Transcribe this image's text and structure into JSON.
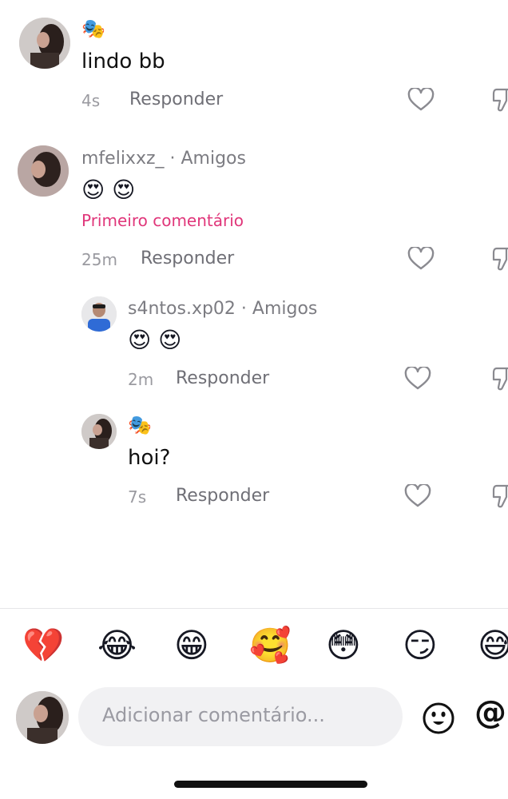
{
  "comments": [
    {
      "username": "",
      "badge_emoji": "🎭",
      "text": "lindo bb",
      "time": "4s",
      "reply_label": "Responder"
    },
    {
      "username": "mfelixxz_ · Amigos",
      "text": "😍 😍",
      "first_comment_label": "Primeiro comentário",
      "time": "25m",
      "reply_label": "Responder"
    },
    {
      "username": "s4ntos.xp02 · Amigos",
      "text": "😍 😍",
      "time": "2m",
      "reply_label": "Responder"
    },
    {
      "username": "",
      "badge_emoji": "🎭",
      "text": "hoi?",
      "time": "7s",
      "reply_label": "Responder"
    }
  ],
  "quick_emojis": [
    "💔",
    "😂",
    "😁",
    "🥰",
    "😳",
    "😏",
    "😅"
  ],
  "input": {
    "placeholder": "Adicionar comentário...",
    "at_symbol": "@"
  },
  "colors": {
    "accent_first_comment": "#e0367a",
    "input_background": "#f1f1f3"
  },
  "icons": {
    "like": "heart-outline-icon",
    "dislike": "thumbs-down-outline-icon",
    "emoji": "smiley-face-icon"
  }
}
